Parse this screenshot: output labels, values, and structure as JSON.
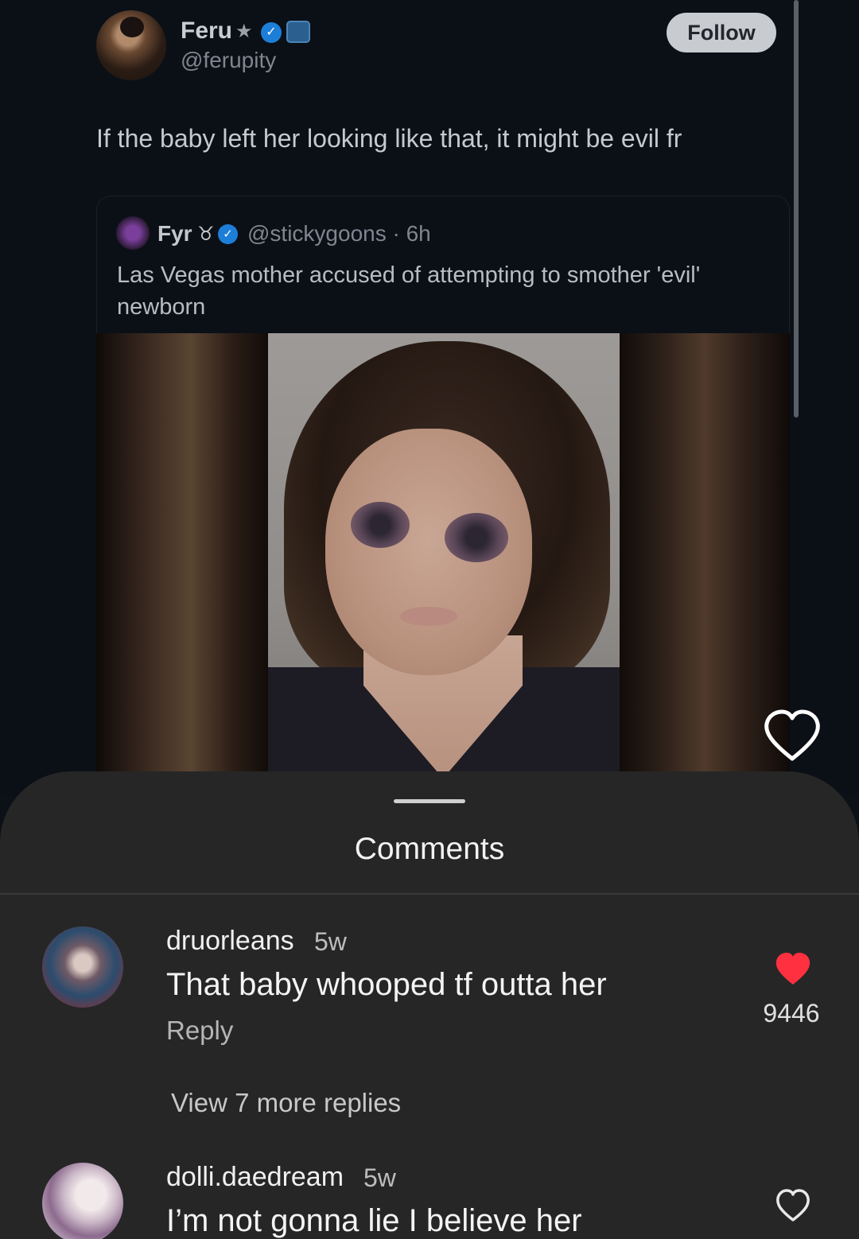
{
  "tweet": {
    "author_name": "Feru",
    "author_star": "★",
    "author_handle": "@ferupity",
    "follow_label": "Follow",
    "text": "If the baby left her looking like that, it might be evil fr",
    "quote": {
      "name": "Fyr",
      "flag": "♉",
      "handle_time": "@stickygoons · 6h",
      "text": "Las Vegas mother accused of attempting to smother 'evil' newborn"
    },
    "media_icon": "photo-image"
  },
  "comments_sheet": {
    "title": "Comments",
    "comments": [
      {
        "user": "druorleans",
        "time": "5w",
        "text": "That baby whooped tf outta her",
        "reply_label": "Reply",
        "likes": "9446",
        "liked": true,
        "view_more": "View 7 more replies"
      },
      {
        "user": "dolli.daedream",
        "time": "5w",
        "text": "I’m not gonna lie I believe her",
        "liked": false
      }
    ]
  },
  "colors": {
    "verified_blue": "#1d7ed8",
    "like_red": "#ff3040",
    "sheet_bg": "#262626"
  }
}
